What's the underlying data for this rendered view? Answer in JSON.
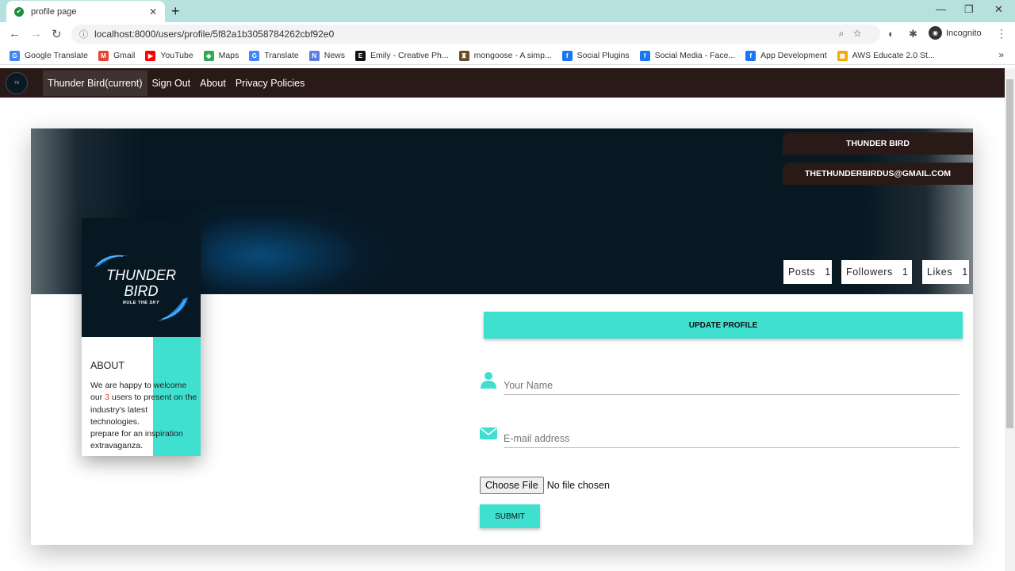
{
  "browser": {
    "tab_title": "profile page",
    "new_tab": "+",
    "url": "localhost:8000/users/profile/5f82a1b3058784262cbf92e0",
    "incognito_label": "Incognito",
    "bookmarks": [
      {
        "label": "Google Translate",
        "color": "#4285f4",
        "glyph": "G"
      },
      {
        "label": "Gmail",
        "color": "#ea4335",
        "glyph": "M"
      },
      {
        "label": "YouTube",
        "color": "#ff0000",
        "glyph": "▶"
      },
      {
        "label": "Maps",
        "color": "#34a853",
        "glyph": "◆"
      },
      {
        "label": "Translate",
        "color": "#4285f4",
        "glyph": "G"
      },
      {
        "label": "News",
        "color": "#5b7fd8",
        "glyph": "N"
      },
      {
        "label": "Emily - Creative Ph...",
        "color": "#111111",
        "glyph": "E"
      },
      {
        "label": "mongoose - A simp...",
        "color": "#6b4e2e",
        "glyph": "♜"
      },
      {
        "label": "Social Plugins",
        "color": "#1877f2",
        "glyph": "f"
      },
      {
        "label": "Social Media - Face...",
        "color": "#1877f2",
        "glyph": "f"
      },
      {
        "label": "App Development",
        "color": "#1877f2",
        "glyph": "f"
      },
      {
        "label": "AWS Educate 2.0 St...",
        "color": "#f2a900",
        "glyph": "▣"
      }
    ],
    "bookmarks_more": "»"
  },
  "nav": {
    "links": [
      "Thunder Bird(current)",
      "Sign Out",
      "About",
      "Privacy Policies"
    ]
  },
  "profile": {
    "name": "THUNDER BIRD",
    "email": "THETHUNDERBIRDUS@GMAIL.COM",
    "stats": [
      {
        "label": "Posts",
        "value": "1"
      },
      {
        "label": "Followers",
        "value": "1"
      },
      {
        "label": "Likes",
        "value": "1"
      }
    ],
    "logo_line1": "THUNDER",
    "logo_line2": "BIRD",
    "logo_tagline": "RULE THE SKY",
    "about_title": "ABOUT",
    "about_part1": "We are happy to welcome our ",
    "about_count": "3",
    "about_part2": " users to present on the industry's latest technologies.",
    "about_part3": "prepare for an inspiration extravaganza."
  },
  "form": {
    "update_label": "UPDATE PROFILE",
    "name_placeholder": "Your Name",
    "email_placeholder": "E-mail address",
    "file_button": "Choose File",
    "file_status": "No file chosen",
    "submit_label": "SUBMIT"
  },
  "colors": {
    "accent": "#40e0d0",
    "navbar": "#2a1a17",
    "cover": "#071822"
  }
}
